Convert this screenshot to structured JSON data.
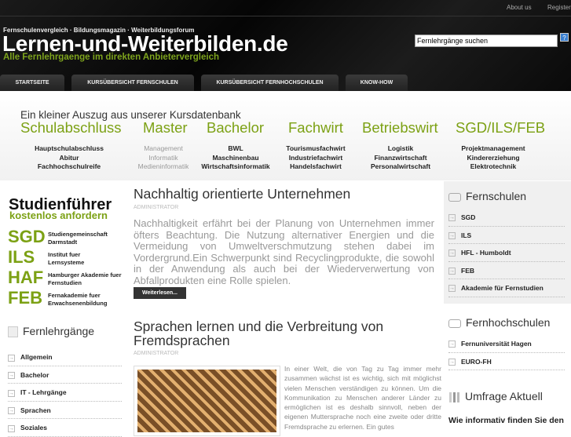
{
  "header": {
    "top_links": [
      "About us",
      "Register"
    ],
    "tagline": "Fernschulenvergleich · Bildungsmagazin · Weiterbildungsforum",
    "title": "Lernen-und-Weiterbilden.de",
    "subtitle": "Alle Fernlehrgaenge im direkten Anbietervergleich",
    "search_value": "Fernlehrgänge suchen",
    "help_label": "?"
  },
  "nav": [
    "STARTSEITE",
    "KURSÜBERSICHT FERNSCHULEN",
    "KURSÜBERSICHT FERNHOCHSCHULEN",
    "KNOW-HOW"
  ],
  "courses": {
    "heading": "Ein kleiner Auszug aus unserer Kursdatenbank",
    "categories": [
      {
        "name": "Schulabschluss",
        "items": [
          "Hauptschulabschluss",
          "Abitur",
          "Fachhochschulreife"
        ]
      },
      {
        "name": "Master",
        "items": [
          "Management",
          "Informatik",
          "Medieninformatik"
        ]
      },
      {
        "name": "Bachelor",
        "items": [
          "BWL",
          "Maschinenbau",
          "Wirtschaftsinformatik"
        ]
      },
      {
        "name": "Fachwirt",
        "items": [
          "Tourismusfachwirt",
          "Industriefachwirt",
          "Handelsfachwirt"
        ]
      },
      {
        "name": "Betriebswirt",
        "items": [
          "Logistik",
          "Finanzwirtschaft",
          "Personalwirtschaft"
        ]
      },
      {
        "name": "SGD/ILS/FEB",
        "items": [
          "Projektmanagement",
          "Kindererziehung",
          "Elektrotechnik"
        ]
      }
    ]
  },
  "studienfuehrer": {
    "title": "Studienführer",
    "subtitle": "kostenlos anfordern",
    "schools": [
      {
        "abbr": "SGD",
        "name": "Studiengemeinschaft Darmstadt"
      },
      {
        "abbr": "ILS",
        "name": "Institut fuer Lernsysteme"
      },
      {
        "abbr": "HAF",
        "name": "Hamburger Akademie fuer Fernstudien"
      },
      {
        "abbr": "FEB",
        "name": "Fernakademie fuer Erwachsenenbildung"
      }
    ]
  },
  "fernlehrgaenge": {
    "heading": "Fernlehrgänge",
    "items": [
      "Allgemein",
      "Bachelor",
      "IT - Lehrgänge",
      "Sprachen",
      "Soziales"
    ]
  },
  "articles": [
    {
      "title": "Nachhaltig orientierte Unternehmen",
      "author": "ADMINISTRATOR",
      "text": "Nachhaltigkeit erfährt bei der Planung von Unternehmen immer öfters Beachtung. Die Nutzung alternativer Energien und die Vermeidung von Umweltverschmutzung stehen dabei im Vordergrund.Ein Schwerpunkt sind Recyclingprodukte, die sowohl in der Anwendung als auch bei der Wiederverwertung von Abfallprodukten eine Rolle spielen.",
      "more": "Weiterlesen..."
    },
    {
      "title": "Sprachen lernen und die Verbreitung von Fremdsprachen",
      "author": "ADMINISTRATOR",
      "text": "In einer Welt, die von Tag zu Tag immer mehr zusammen wächst ist es wichtig, sich mit möglichst vielen Menschen verständigen zu können. Um die Kommunikation zu Menschen anderer Länder zu ermöglichen ist es deshalb sinnvoll, neben der eigenen Muttersprache noch eine zweite oder dritte Fremdsprache zu erlernen. Ein gutes"
    }
  ],
  "fernschulen": {
    "heading": "Fernschulen",
    "items": [
      "SGD",
      "ILS",
      "HFL - Humboldt",
      "FEB",
      "Akademie für Fernstudien"
    ]
  },
  "fernhochschulen": {
    "heading": "Fernhochschulen",
    "items": [
      "Fernuniversität Hagen",
      "EURO-FH"
    ]
  },
  "umfrage": {
    "heading": "Umfrage Aktuell",
    "question": "Wie informativ finden Sie den"
  }
}
